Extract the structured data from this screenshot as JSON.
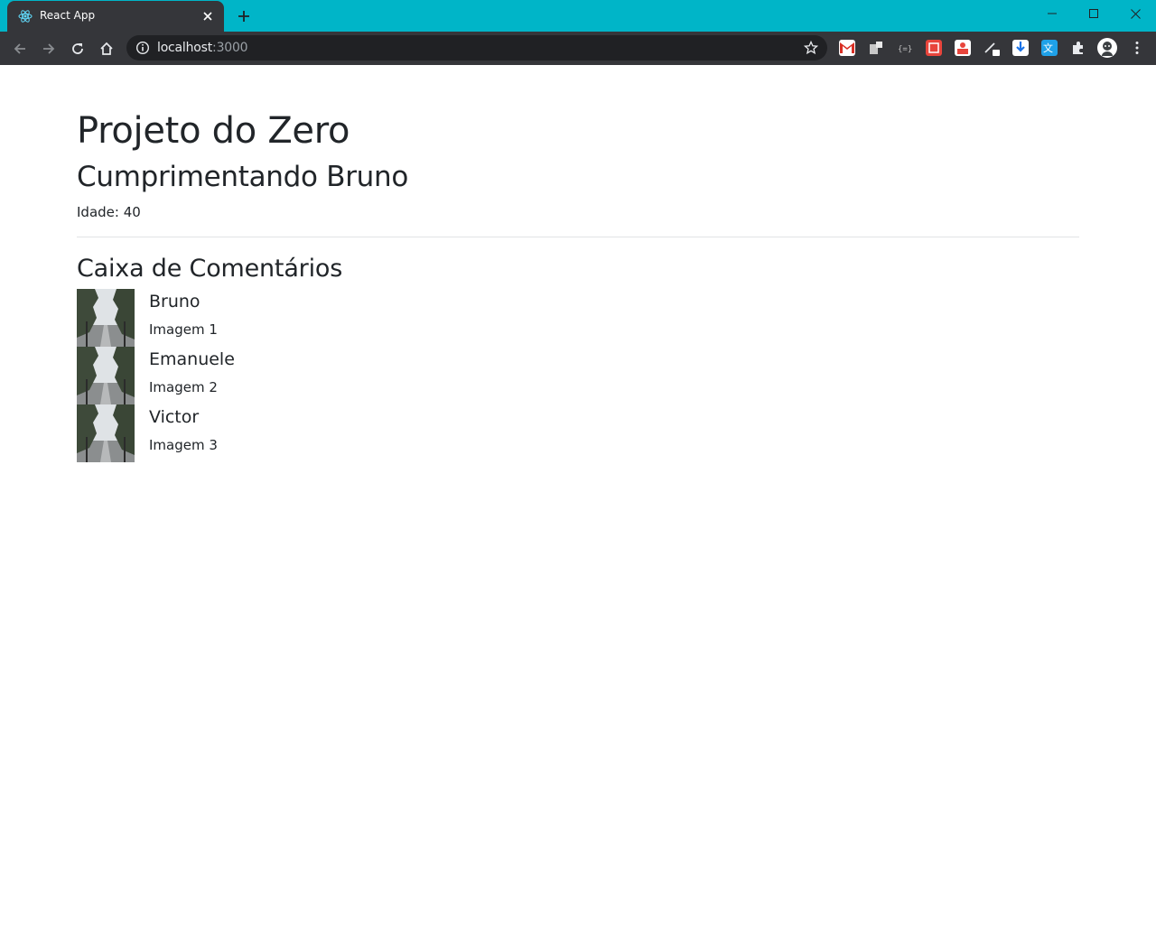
{
  "browser": {
    "tab_title": "React App",
    "url_host": "localhost",
    "url_port": ":3000",
    "icons": {
      "favicon": "react-logo-icon",
      "close": "close-icon",
      "new_tab": "plus-icon",
      "back": "arrow-left-icon",
      "forward": "arrow-right-icon",
      "reload": "reload-icon",
      "home": "home-icon",
      "site_info": "info-icon",
      "bookmark": "star-icon",
      "extensions": "puzzle-icon",
      "menu": "kebab-menu-icon"
    },
    "colors": {
      "tabstrip": "#00b5c8",
      "toolbar": "#35363a",
      "omnibox": "#202124"
    }
  },
  "page": {
    "title": "Projeto do Zero",
    "greeting": "Cumprimentando Bruno",
    "age_label": "Idade: 40",
    "comments_title": "Caixa de Comentários",
    "comments": [
      {
        "name": "Bruno",
        "text": "Imagem 1"
      },
      {
        "name": "Emanuele",
        "text": "Imagem 2"
      },
      {
        "name": "Victor",
        "text": "Imagem 3"
      }
    ]
  }
}
